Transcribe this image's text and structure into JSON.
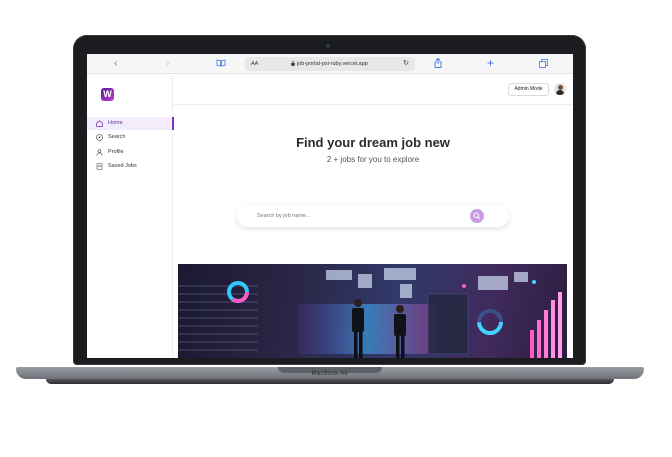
{
  "device": {
    "label": "MacBook Air"
  },
  "browser": {
    "text_size_label": "AA",
    "url": "job-portal-psi-ruby.vercel.app"
  },
  "app": {
    "logo_letter": "W",
    "nav": [
      {
        "label": "Home",
        "icon": "home-icon",
        "active": true
      },
      {
        "label": "Search",
        "icon": "compass-icon",
        "active": false
      },
      {
        "label": "Profile",
        "icon": "user-icon",
        "active": false
      },
      {
        "label": "Saved Jobs",
        "icon": "bookmark-icon",
        "active": false
      }
    ],
    "topbar": {
      "admin_label": "Admin Mode"
    },
    "hero": {
      "title": "Find your dream job new",
      "subtitle": "2 + jobs for you to explore"
    },
    "search": {
      "placeholder": "Search by job name..."
    }
  },
  "colors": {
    "accent": "#7b35c4",
    "active_bg": "#f3ecfb",
    "search_button": "#c99be8",
    "link_blue": "#3a7be0"
  }
}
